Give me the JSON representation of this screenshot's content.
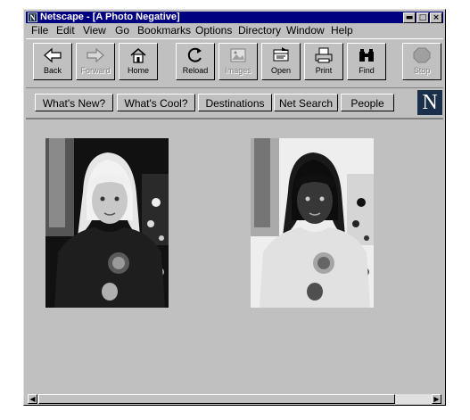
{
  "window": {
    "title": "Netscape - [A Photo Negative]",
    "controls": {
      "minimize": "▬",
      "maximize": "□",
      "close": "×"
    }
  },
  "menu": [
    "File",
    "Edit",
    "View",
    "Go",
    "Bookmarks",
    "Options",
    "Directory",
    "Window",
    "Help"
  ],
  "toolbar": [
    {
      "label": "Back",
      "icon": "back-arrow-icon",
      "enabled": true
    },
    {
      "label": "Forward",
      "icon": "forward-arrow-icon",
      "enabled": false
    },
    {
      "label": "Home",
      "icon": "home-icon",
      "enabled": true
    },
    {
      "label": "Reload",
      "icon": "reload-icon",
      "enabled": true
    },
    {
      "label": "Images",
      "icon": "images-icon",
      "enabled": false
    },
    {
      "label": "Open",
      "icon": "open-icon",
      "enabled": true
    },
    {
      "label": "Print",
      "icon": "print-icon",
      "enabled": true
    },
    {
      "label": "Find",
      "icon": "find-icon",
      "enabled": true
    },
    {
      "label": "Stop",
      "icon": "stop-icon",
      "enabled": false
    }
  ],
  "directory_buttons": [
    "What's New?",
    "What's Cool?",
    "Destinations",
    "Net Search",
    "People"
  ],
  "logo_letter": "N",
  "colors": {
    "titlebar": "#000080",
    "chrome": "#c0c0c0",
    "logo_bg": "#1a2f4a"
  },
  "content": {
    "images": [
      {
        "name": "original-photo",
        "description": "Black-and-white photo of a young girl"
      },
      {
        "name": "negative-photo",
        "description": "Photo negative of the same image"
      }
    ]
  }
}
